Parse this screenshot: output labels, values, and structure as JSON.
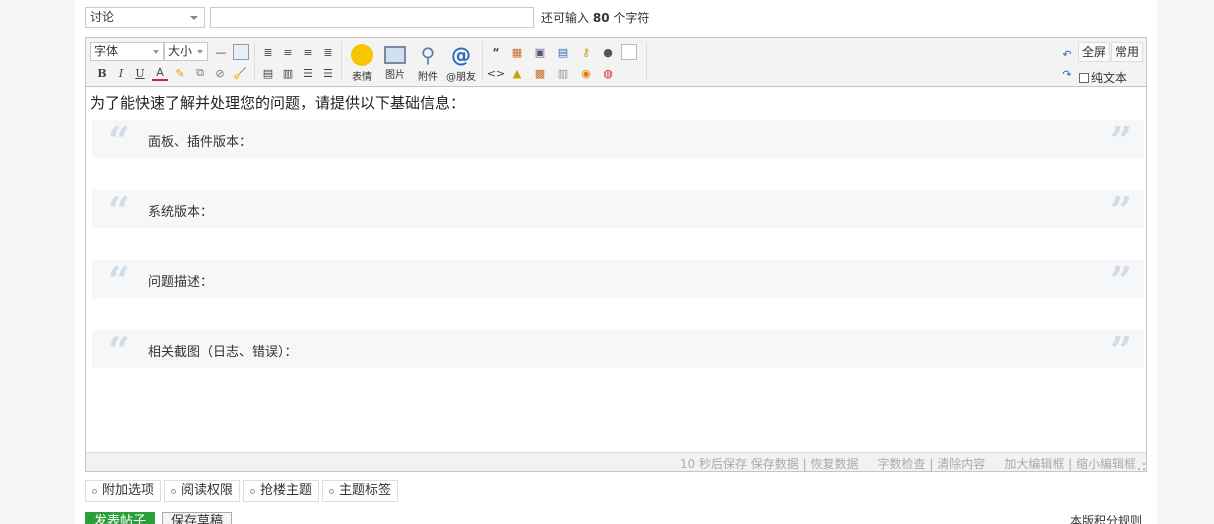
{
  "header": {
    "type_select": "讨论",
    "title_input_value": "",
    "char_remain_prefix": "还可输入",
    "char_remain_count": "80",
    "char_remain_suffix": "个字符"
  },
  "toolbar": {
    "font_select": "字体",
    "size_select": "大小",
    "emoticon_label": "表情",
    "image_label": "图片",
    "attach_label": "附件",
    "at_label": "@朋友",
    "fullscreen_label": "全屏",
    "common_label": "常用",
    "plaintext_label": "纯文本",
    "bold": "B",
    "italic": "I",
    "underline": "U",
    "fontcolor": "A",
    "quote_icon": "“",
    "code_icon": "<>"
  },
  "content": {
    "intro": "为了能快速了解并处理您的问题，请提供以下基础信息：",
    "quotes": [
      "面板、插件版本：",
      "系统版本：",
      "问题描述：",
      "相关截图（日志、错误）："
    ]
  },
  "status": {
    "autosave": "10 秒后保存 保存数据 | 恢复数据",
    "wordcheck": "字数检查 | 清除内容",
    "resize": "加大编辑框 | 缩小编辑框"
  },
  "options": {
    "tabs": [
      "附加选项",
      "阅读权限",
      "抢楼主题",
      "主题标签"
    ]
  },
  "footer": {
    "submit_label": "发表帖子",
    "draft_label": "保存草稿",
    "rules_label": "本版积分规则"
  },
  "colors": {
    "submit_green": "#2c9e3b",
    "quote_mark": "#d2dce6"
  }
}
